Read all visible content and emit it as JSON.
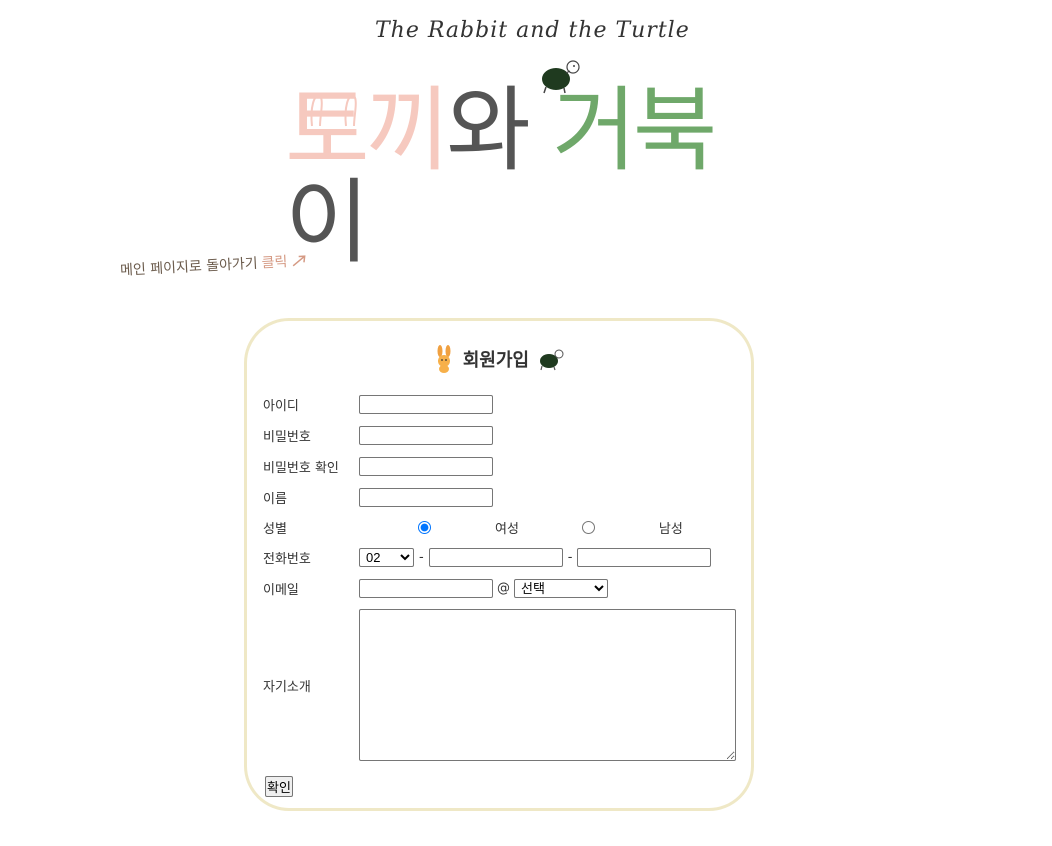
{
  "logo": {
    "subtitle": "The Rabbit and the Turtle",
    "title_rabbit": "토끼",
    "title_wa": "와",
    "title_turtle": "거북",
    "title_i": "이"
  },
  "back_link": {
    "text": "메인 페이지로 돌아가기",
    "click": "클릭"
  },
  "form": {
    "title": "회원가입",
    "labels": {
      "id": "아이디",
      "password": "비밀번호",
      "password_confirm": "비밀번호 확인",
      "name": "이름",
      "gender": "성별",
      "phone": "전화번호",
      "email": "이메일",
      "intro": "자기소개"
    },
    "gender": {
      "female": "여성",
      "male": "남성",
      "selected": "female"
    },
    "phone": {
      "area_code": "02",
      "separator": "-"
    },
    "email": {
      "at": "@",
      "domain_select": "선택"
    },
    "submit": "확인"
  },
  "colors": {
    "card_border": "#efe8c6",
    "rabbit_pink": "#f6c9bf",
    "turtle_green": "#6fa86a",
    "back_link": "#6b5b4c",
    "click": "#d59a84"
  }
}
